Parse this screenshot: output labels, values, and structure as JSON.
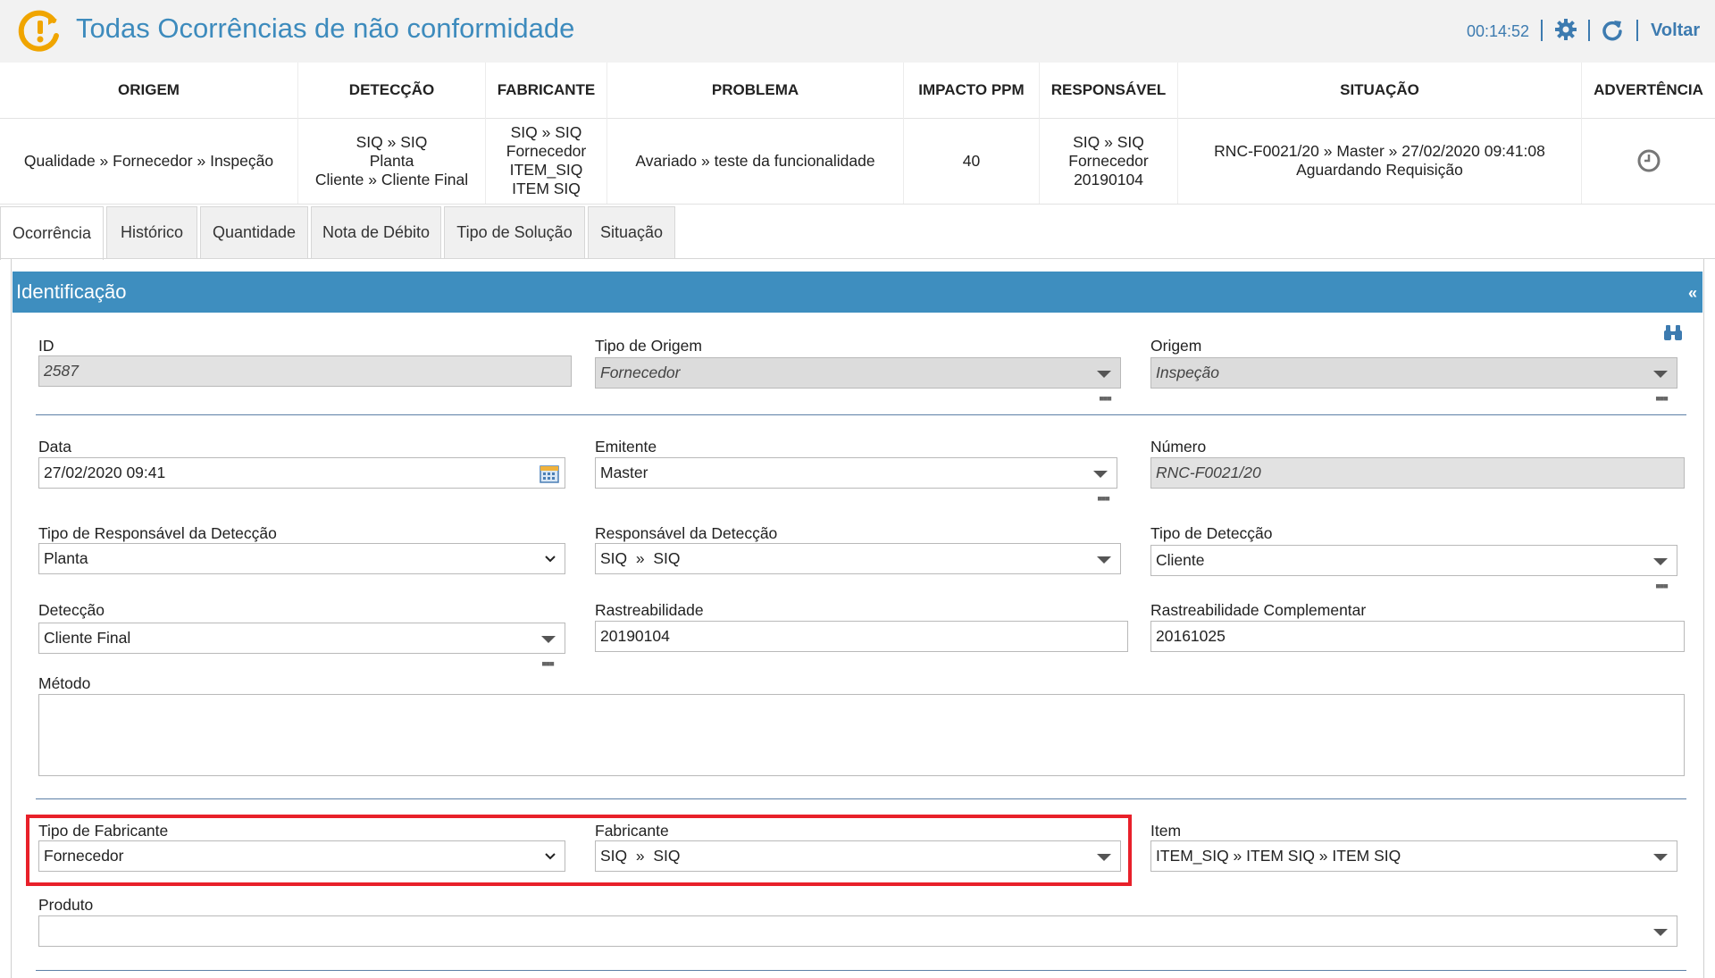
{
  "header": {
    "title": "Todas Ocorrências de não conformidade",
    "timer": "00:14:52",
    "back_label": "Voltar",
    "icons": [
      "warning-refresh-icon",
      "gear-icon",
      "refresh-icon"
    ]
  },
  "summary": {
    "headers": [
      "ORIGEM",
      "DETECÇÃO",
      "FABRICANTE",
      "PROBLEMA",
      "IMPACTO PPM",
      "RESPONSÁVEL",
      "SITUAÇÃO",
      "ADVERTÊNCIA"
    ],
    "origem": "Qualidade » Fornecedor » Inspeção",
    "deteccao": [
      "SIQ » SIQ",
      "Planta",
      "Cliente » Cliente Final"
    ],
    "fabricante": [
      "SIQ » SIQ",
      "Fornecedor",
      "ITEM_SIQ",
      "ITEM SIQ"
    ],
    "problema": "Avariado » teste da funcionalidade",
    "impacto": "40",
    "responsavel": [
      "SIQ » SIQ",
      "Fornecedor",
      "20190104"
    ],
    "situacao": [
      "RNC-F0021/20 » Master » 27/02/2020 09:41:08",
      "Aguardando Requisição"
    ]
  },
  "tabs": [
    "Ocorrência",
    "Histórico",
    "Quantidade",
    "Nota de Débito",
    "Tipo de Solução",
    "Situação"
  ],
  "section": {
    "title": "Identificação",
    "collapse": "«"
  },
  "form": {
    "id": {
      "label": "ID",
      "value": "2587"
    },
    "tipo_origem": {
      "label": "Tipo de Origem",
      "value": "Fornecedor"
    },
    "origem": {
      "label": "Origem",
      "value": "Inspeção"
    },
    "data": {
      "label": "Data",
      "value": "27/02/2020 09:41"
    },
    "emitente": {
      "label": "Emitente",
      "value": "Master"
    },
    "numero": {
      "label": "Número",
      "value": "RNC-F0021/20"
    },
    "tipo_resp": {
      "label": "Tipo de Responsável da Detecção",
      "value": "Planta"
    },
    "resp_det": {
      "label": "Responsável da Detecção",
      "value": "SIQ  »  SIQ"
    },
    "tipo_det": {
      "label": "Tipo de Detecção",
      "value": "Cliente"
    },
    "deteccao": {
      "label": "Detecção",
      "value": "Cliente Final"
    },
    "rastreabilidade": {
      "label": "Rastreabilidade",
      "value": "20190104"
    },
    "rastreabilidade_comp": {
      "label": "Rastreabilidade Complementar",
      "value": "20161025"
    },
    "metodo": {
      "label": "Método",
      "value": ""
    },
    "tipo_fabricante": {
      "label": "Tipo de Fabricante",
      "value": "Fornecedor"
    },
    "fabricante": {
      "label": "Fabricante",
      "value": "SIQ  »  SIQ"
    },
    "item": {
      "label": "Item",
      "value": "ITEM_SIQ » ITEM SIQ » ITEM SIQ"
    },
    "produto": {
      "label": "Produto",
      "value": ""
    },
    "more_dots": "▪▪▪"
  },
  "colors": {
    "accent": "#3e8ebf",
    "highlight": "#e8202a",
    "logo": "#f0a500"
  }
}
